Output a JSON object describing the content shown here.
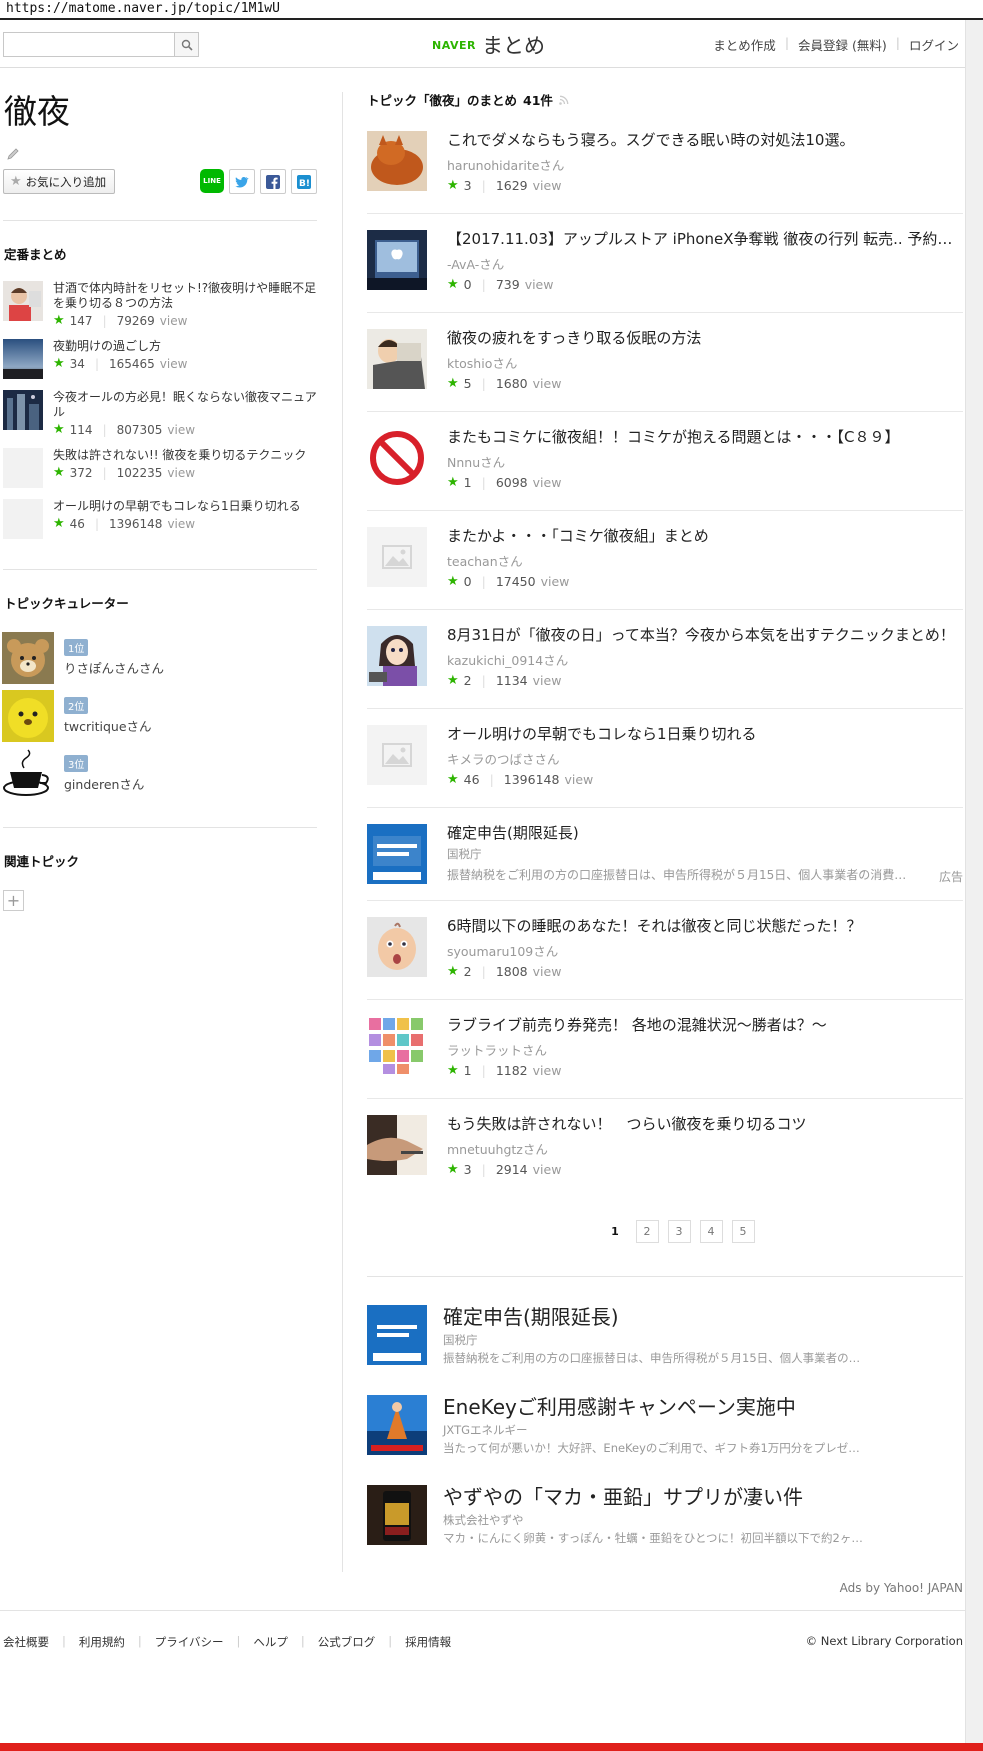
{
  "url": "https://matome.naver.jp/topic/1M1wU",
  "header": {
    "search_placeholder": "",
    "logo_brand": "NAVER",
    "logo_text": "まとめ",
    "links": [
      "まとめ作成",
      "会員登録 (無料)",
      "ログイン"
    ]
  },
  "topic": {
    "title": "徹夜",
    "favorite_label": "お気に入り追加",
    "share": [
      "LINE",
      "twitter",
      "facebook",
      "hatena"
    ]
  },
  "standard": {
    "heading": "定番まとめ",
    "items": [
      {
        "title": "甘酒で体内時計をリセット!?徹夜明けや睡眠不足を乗り切る８つの方法",
        "favs": "147",
        "views": "79269",
        "thumb": "person"
      },
      {
        "title": "夜勤明けの過ごし方",
        "favs": "34",
        "views": "165465",
        "thumb": "dusk"
      },
      {
        "title": "今夜オールの方必見！眠くならない徹夜マニュアル",
        "favs": "114",
        "views": "807305",
        "thumb": "night"
      },
      {
        "title": "失敗は許されない!! 徹夜を乗り切るテクニック",
        "favs": "372",
        "views": "102235",
        "thumb": "blank"
      },
      {
        "title": "オール明けの早朝でもコレなら1日乗り切れる",
        "favs": "46",
        "views": "1396148",
        "thumb": "blank"
      }
    ],
    "view_unit": "view"
  },
  "curators": {
    "heading": "トピックキュレーター",
    "items": [
      {
        "rank": "1位",
        "name": "りさぽんさんさん"
      },
      {
        "rank": "2位",
        "name": "twcritiqueさん"
      },
      {
        "rank": "3位",
        "name": "ginderenさん"
      }
    ]
  },
  "related": {
    "heading": "関連トピック",
    "add_label": "+"
  },
  "list": {
    "heading": "トピック「徹夜」のまとめ",
    "count": "41件",
    "articles": [
      {
        "title": "これでダメならもう寝ろ。スグできる眠い時の対処法10選。",
        "author": "harunohidariteさん",
        "favs": "3",
        "views": "1629"
      },
      {
        "title": "【2017.11.03】アップルストア iPhoneX争奪戦 徹夜の行列 転売.. 予約…",
        "author": "-AvA-さん",
        "favs": "0",
        "views": "739"
      },
      {
        "title": "徹夜の疲れをすっきり取る仮眠の方法",
        "author": "ktoshioさん",
        "favs": "5",
        "views": "1680"
      },
      {
        "title": "またもコミケに徹夜組！！コミケが抱える問題とは・・・【C８９】",
        "author": "Nnnuさん",
        "favs": "1",
        "views": "6098"
      },
      {
        "title": "またかよ・・・「コミケ徹夜組」まとめ",
        "author": "teachanさん",
        "favs": "0",
        "views": "17450"
      },
      {
        "title": "8月31日が「徹夜の日」って本当？今夜から本気を出すテクニックまとめ！",
        "author": "kazukichi_0914さん",
        "favs": "2",
        "views": "1134"
      },
      {
        "title": "オール明けの早朝でもコレなら1日乗り切れる",
        "author": "キメラのつばささん",
        "favs": "46",
        "views": "1396148"
      }
    ],
    "inline_ad": {
      "title": "確定申告(期限延長)",
      "source": "国税庁",
      "desc": "振替納税をご利用の方の口座振替日は、申告所得税が５月15日、個人事業者の消費…",
      "label": "広告"
    },
    "articles2": [
      {
        "title": "6時間以下の睡眠のあなた！それは徹夜と同じ状態だった！？",
        "author": "syoumaru109さん",
        "favs": "2",
        "views": "1808"
      },
      {
        "title": "ラブライブ前売り券発売！ 各地の混雑状況〜勝者は？〜",
        "author": "ラットラットさん",
        "favs": "1",
        "views": "1182"
      },
      {
        "title": "もう失敗は許されない！　つらい徹夜を乗り切るコツ",
        "author": "mnetuuhgtzさん",
        "favs": "3",
        "views": "2914"
      }
    ],
    "view_unit": "view",
    "pages": [
      "1",
      "2",
      "3",
      "4",
      "5"
    ]
  },
  "ads": {
    "items": [
      {
        "title": "確定申告(期限延長)",
        "source": "国税庁",
        "desc": "振替納税をご利用の方の口座振替日は、申告所得税が５月15日、個人事業者の消費…"
      },
      {
        "title": "EneKeyご利用感謝キャンペーン実施中",
        "source": "JXTGエネルギー",
        "desc": "当たって何が悪いか！大好評、EneKeyのご利用で、ギフト券1万円分をプレゼ…"
      },
      {
        "title": "やずやの「マカ・亜鉛」サプリが凄い件",
        "source": "株式会社やずや",
        "desc": "マカ・にんにく卵黄・すっぽん・牡蠣・亜鉛をひとつに！初回半額以下で約2ヶ月分…"
      }
    ],
    "by": "Ads by Yahoo! JAPAN"
  },
  "footer": {
    "links": [
      "会社概要",
      "利用規約",
      "プライバシー",
      "ヘルプ",
      "公式ブログ",
      "採用情報"
    ],
    "copyright": "© Next Library Corporation"
  },
  "colors": {
    "accent_green": "#2db400",
    "rank_badge": "#8fb0d0",
    "bottom_bar": "#e0201b"
  }
}
